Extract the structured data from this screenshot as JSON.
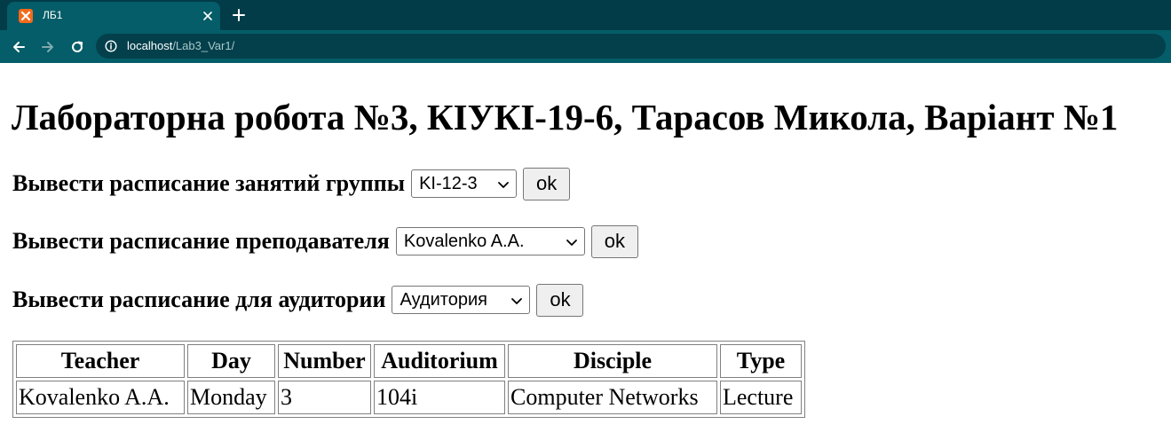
{
  "browser": {
    "tab_title": "ЛБ1",
    "url_host": "localhost",
    "url_path": "/Lab3_Var1/",
    "colors": {
      "tabbar": "#013c48",
      "toolbar": "#045d68",
      "favicon": "#f26b1d"
    },
    "icons": [
      "xampp-favicon-icon",
      "close-icon",
      "plus-icon",
      "back-arrow-icon",
      "forward-arrow-icon",
      "reload-icon",
      "info-icon"
    ]
  },
  "page": {
    "title": "Лабораторна робота №3, КІУКІ-19-6, Тарасов Микола, Варіант №1",
    "forms": [
      {
        "label": "Вывести расписание занятий группы",
        "selected": "KI-12-3",
        "button": "ok"
      },
      {
        "label": "Вывести расписание преподавателя",
        "selected": "Kovalenko A.A.",
        "button": "ok"
      },
      {
        "label": "Вывести расписание для аудитории",
        "selected": "Аудитория",
        "button": "ok"
      }
    ],
    "table": {
      "headers": [
        "Teacher",
        "Day",
        "Number",
        "Auditorium",
        "Disciple",
        "Type"
      ],
      "rows": [
        [
          "Kovalenko A.A.",
          "Monday",
          "3",
          "104i",
          "Computer Networks",
          "Lecture"
        ]
      ]
    }
  }
}
